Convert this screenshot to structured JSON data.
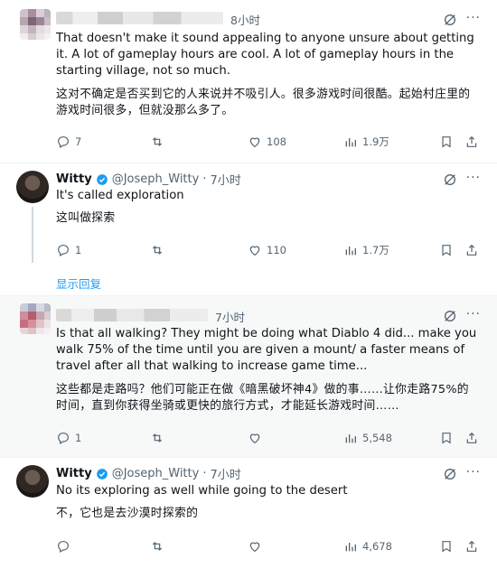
{
  "posts": [
    {
      "time": "8小时",
      "text_en": "That doesn't make it sound appealing to anyone unsure about getting it. A lot of gameplay hours are cool. A lot of gameplay hours in the starting village, not so much.",
      "text_cn": "这对不确定是否买到它的人来说并不吸引人。很多游戏时间很酷。起始村庄里的游戏时间很多，但就没那么多了。",
      "replies": "7",
      "retweets": "",
      "likes": "108",
      "views": "1.9万"
    },
    {
      "name": "Witty",
      "handle": "@Joseph_Witty",
      "dot": "·",
      "time": "7小时",
      "text_en": "It's called exploration",
      "text_cn": "这叫做探索",
      "replies": "1",
      "retweets": "",
      "likes": "110",
      "views": "1.7万"
    },
    {
      "time": "7小时",
      "text_en": "Is that all walking? They might be doing what Diablo 4 did... make you walk 75% of the time until you are given a mount/ a faster means of travel after all that walking to increase game time...",
      "text_cn": "这些都是走路吗？他们可能正在做《暗黑破坏神4》做的事……让你走路75%的时间，直到你获得坐骑或更快的旅行方式，才能延长游戏时间……",
      "replies": "1",
      "retweets": "",
      "likes": "",
      "views": "5,548"
    },
    {
      "name": "Witty",
      "handle": "@Joseph_Witty",
      "dot": "·",
      "time": "7小时",
      "text_en": "No its exploring as well while going to the desert",
      "text_cn": "不，它也是去沙漠时探索的",
      "replies": "",
      "retweets": "",
      "likes": "",
      "views": "4,678"
    }
  ],
  "show_replies": "显示回复",
  "more_label": "···",
  "colors": {
    "accent": "#1d9bf0",
    "text": "#0f1419",
    "muted": "#536471",
    "divider": "#eff3f4",
    "highlight": "#f7f9f9"
  },
  "icons": [
    "reply-icon",
    "retweet-icon",
    "like-icon",
    "views-icon",
    "bookmark-icon",
    "share-icon",
    "grok-icon",
    "verified-icon",
    "more-icon"
  ]
}
